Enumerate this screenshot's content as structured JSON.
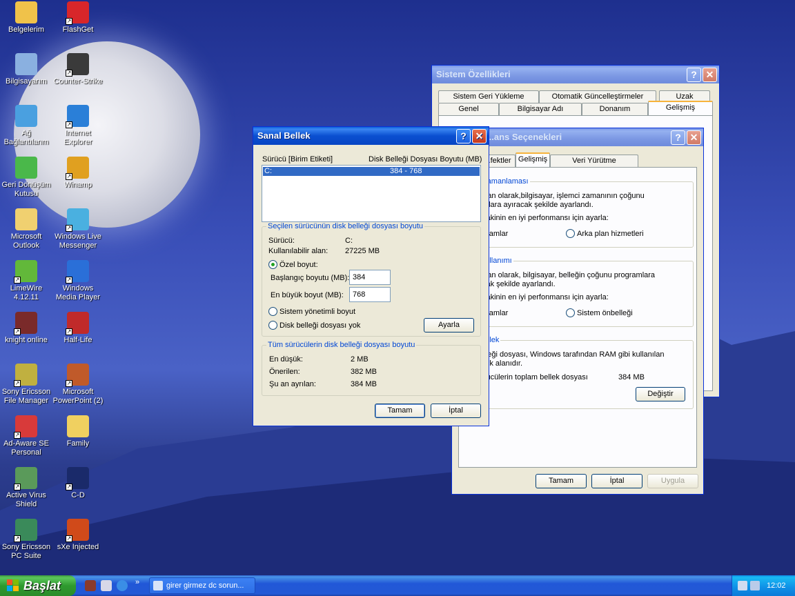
{
  "colors": {
    "xp_blue": "#0a4fd0",
    "dialog_bg": "#ece9d8",
    "group_label": "#0046d5",
    "start_green": "#2f9a2f"
  },
  "desktop": {
    "icons": [
      {
        "label": "Belgelerim",
        "icon": "my-documents-icon"
      },
      {
        "label": "FlashGet",
        "icon": "flashget-icon"
      },
      {
        "label": "Bilgisayarım",
        "icon": "my-computer-icon"
      },
      {
        "label": "Counter-Strike",
        "icon": "counter-strike-icon"
      },
      {
        "label": "Ağ Bağlantılarım",
        "icon": "network-icon"
      },
      {
        "label": "Internet Explorer",
        "icon": "internet-explorer-icon"
      },
      {
        "label": "Geri Dönüşüm Kutusu",
        "icon": "recycle-bin-icon"
      },
      {
        "label": "Winamp",
        "icon": "winamp-icon"
      },
      {
        "label": "Microsoft Outlook",
        "icon": "outlook-icon"
      },
      {
        "label": "Windows Live Messenger",
        "icon": "messenger-icon"
      },
      {
        "label": "LimeWire 4.12.11",
        "icon": "limewire-icon"
      },
      {
        "label": "Windows Media Player",
        "icon": "media-player-icon"
      },
      {
        "label": "knight online",
        "icon": "knight-online-icon"
      },
      {
        "label": "Half-Life",
        "icon": "half-life-icon"
      },
      {
        "label": "Sony Ericsson File Manager",
        "icon": "phone-icon"
      },
      {
        "label": "Microsoft PowerPoint (2)",
        "icon": "powerpoint-icon"
      },
      {
        "label": "Ad-Aware SE Personal",
        "icon": "ad-aware-icon"
      },
      {
        "label": "Family",
        "icon": "folder-icon"
      },
      {
        "label": "Active Virus Shield",
        "icon": "virus-shield-icon"
      },
      {
        "label": "C-D",
        "icon": "cd-icon"
      },
      {
        "label": "Sony Ericsson PC Suite",
        "icon": "pc-suite-icon"
      },
      {
        "label": "sXe Injected",
        "icon": "sxe-icon"
      }
    ]
  },
  "sysprops": {
    "title": "Sistem Özellikleri",
    "tabs_row1": [
      "Sistem Geri Yükleme",
      "Otomatik Güncelleştirmeler",
      "Uzak"
    ],
    "tabs_row2": [
      "Genel",
      "Bilgisayar Adı",
      "Donanım",
      "Gelişmiş"
    ]
  },
  "perf": {
    "title": "...ans Seçenekleri",
    "tabs": [
      "...fektler",
      "Gelişmiş",
      "Veri Yürütme Engellemesi"
    ],
    "group1": {
      "label": "...ci zamanlaması",
      "text1": "...ayılan olarak,bilgisayar, işlemci zamanının çoğunu",
      "text2": "...ramlara ayıracak şekilde ayarlandı.",
      "text3": "...ğıdakinin en iyi perfonmansı için ayarla:",
      "opt1": "...rogramlar",
      "opt2": "Arka plan hizmetleri"
    },
    "group2": {
      "label": "...k kullanımı",
      "text1": "...ayılan olarak, bilgisayar, belleğin çoğunu programlara",
      "text2": "...racak şekilde ayarlandı.",
      "text3": "...ğıdakinin en iyi perfonmansı için ayarla:",
      "opt1": "...rogramlar",
      "opt2": "Sistem önbelleği"
    },
    "group3": {
      "label": "...l bellek",
      "text1": "...belleği dosyası, Windows tarafından RAM gibi kullanılan",
      "text2": "...t disk alanıdır.",
      "text3": "...sürücülerin toplam bellek dosyası",
      "value": "384 MB",
      "change": "Değiştir"
    },
    "ok": "Tamam",
    "cancel": "İptal",
    "apply": "Uygula"
  },
  "vm": {
    "title": "Sanal Bellek",
    "col_drive": "Sürücü  [Birim Etiketi]",
    "col_size": "Disk Belleği Dosyası Boyutu (MB)",
    "list_row": {
      "drive": "C:",
      "size": "384 - 768"
    },
    "selected": {
      "label": "Seçilen sürücünün disk belleği dosyası boyutu",
      "drive_lbl": "Sürücü:",
      "drive_val": "C:",
      "space_lbl": "Kullanılabilir alan:",
      "space_val": "27225 MB",
      "custom": "Özel boyut:",
      "initial_lbl": "Başlangıç boyutu (MB):",
      "initial_val": "384",
      "max_lbl": "En büyük boyut (MB):",
      "max_val": "768",
      "system_managed": "Sistem yönetimli boyut",
      "no_paging": "Disk belleği dosyası yok",
      "set": "Ayarla"
    },
    "total": {
      "label": "Tüm sürücülerin disk belleği dosyası boyutu",
      "min_lbl": "En düşük:",
      "min_val": "2 MB",
      "rec_lbl": "Önerilen:",
      "rec_val": "382 MB",
      "cur_lbl": "Şu an ayrılan:",
      "cur_val": "384 MB"
    },
    "ok": "Tamam",
    "cancel": "İptal"
  },
  "taskbar": {
    "start": "Başlat",
    "task": "girer girmez dc sorun...",
    "clock": "12:02",
    "chevron": "»"
  }
}
